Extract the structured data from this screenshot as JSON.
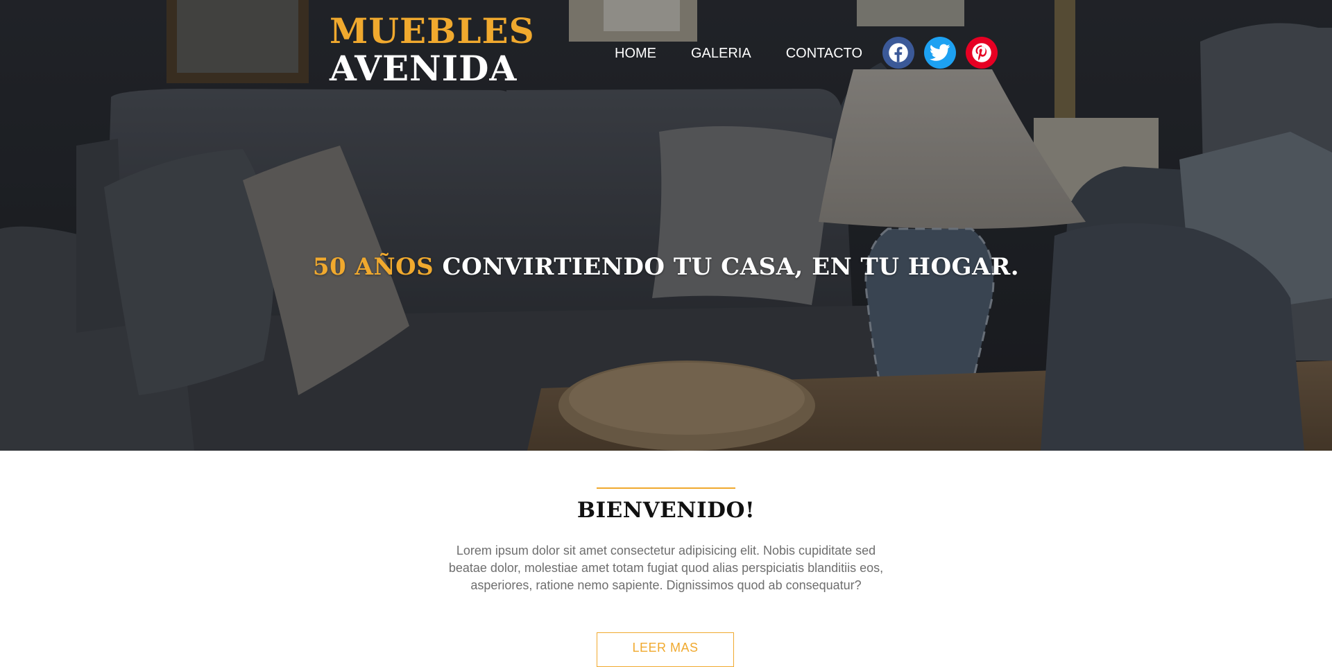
{
  "header": {
    "logo_top": "MUEBLES",
    "logo_bottom": "AVENIDA",
    "nav": [
      "HOME",
      "GALERIA",
      "CONTACTO"
    ],
    "social": [
      {
        "name": "facebook-icon",
        "color": "#3b5998"
      },
      {
        "name": "twitter-icon",
        "color": "#1da1f2"
      },
      {
        "name": "pinterest-icon",
        "color": "#e60023"
      }
    ]
  },
  "hero": {
    "tagline_accent": "50 AÑOS",
    "tagline_rest": "CONVIRTIENDO TU CASA, EN TU HOGAR."
  },
  "welcome": {
    "title": "BIENVENIDO!",
    "text": "Lorem ipsum dolor sit amet consectetur adipisicing elit. Nobis cupiditate sed beatae dolor, molestiae amet totam fugiat quod alias perspiciatis blanditiis eos, asperiores, ratione nemo sapiente. Dignissimos quod ab consequatur?",
    "button": "LEER MAS"
  },
  "colors": {
    "accent": "#f0a92e",
    "text_gray": "#6e6e6e"
  }
}
